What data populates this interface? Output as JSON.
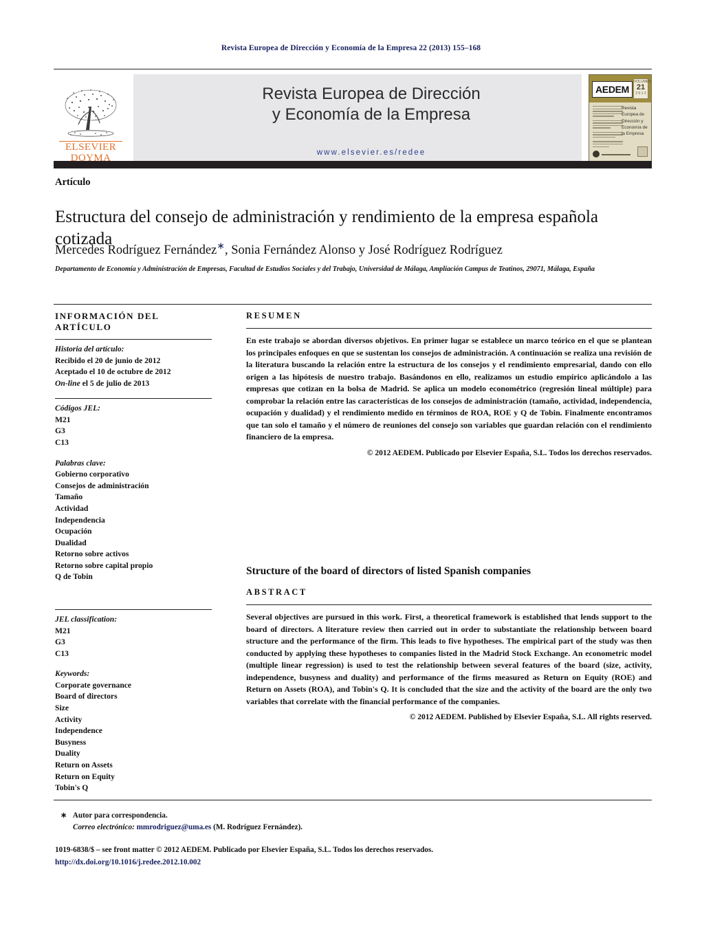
{
  "running_header": "Revista Europea de Dirección y Economía de la Empresa 22 (2013) 155–168",
  "masthead": {
    "publisher_primary": "ELSEVIER",
    "publisher_secondary": "DOYMA",
    "journal_title_line1": "Revista Europea de Dirección",
    "journal_title_line2": "y Economía de la Empresa",
    "journal_url": "www.elsevier.es/redee",
    "cover": {
      "society": "AEDEM",
      "volume_badge_top": "VOLUMEN",
      "volume_badge_number": "21",
      "volume_badge_bottom": "2 0 1 2",
      "cover_title": "Revista Europea de Dirección y Economía de la Empresa"
    }
  },
  "article": {
    "type": "Artículo",
    "title": "Estructura del consejo de administración y rendimiento de la empresa española cotizada",
    "authors": "Mercedes Rodríguez Fernández",
    "authors_rest": ",  Sonia Fernández Alonso y José Rodríguez Rodríguez",
    "corresponding_marker": "∗",
    "affiliation": "Departamento de Economía y Administración de Empresas, Facultad de Estudios Sociales y del Trabajo, Universidad de Málaga, Ampliación Campus de Teatinos, 29071, Málaga, España"
  },
  "info_panel": {
    "heading": "INFORMACIÓN DEL ARTÍCULO",
    "history_label": "Historia del artículo:",
    "history": [
      "Recibido el 20 de junio de 2012",
      "Aceptado el 10 de octubre de 2012"
    ],
    "online_prefix": "On-line",
    "online_rest": " el 5 de julio de 2013",
    "jel_label": "Códigos JEL:",
    "jel_codes": [
      "M21",
      "G3",
      "C13"
    ],
    "keywords_label": "Palabras clave:",
    "keywords": [
      "Gobierno corporativo",
      "Consejos de administración",
      "Tamaño",
      "Actividad",
      "Independencia",
      "Ocupación",
      "Dualidad",
      "Retorno sobre activos",
      "Retorno sobre capital propio",
      "Q de Tobin"
    ],
    "jel_label_en": "JEL classification:",
    "jel_codes_en": [
      "M21",
      "G3",
      "C13"
    ],
    "keywords_label_en": "Keywords:",
    "keywords_en": [
      "Corporate governance",
      "Board of directors",
      "Size",
      "Activity",
      "Independence",
      "Busyness",
      "Duality",
      "Return on Assets",
      "Return on Equity",
      "Tobin's Q"
    ]
  },
  "abstract_es": {
    "heading": "RESUMEN",
    "body": "En este trabajo se abordan diversos objetivos. En primer lugar se establece un marco teórico en el que se plantean los principales enfoques en que se sustentan los consejos de administración. A continuación se realiza una revisión de la literatura buscando la relación entre la estructura de los consejos y el rendimiento empresarial, dando con ello origen a las hipótesis de nuestro trabajo. Basándonos en ello, realizamos un estudio empírico aplicándolo a las empresas que cotizan en la bolsa de Madrid. Se aplica un modelo econométrico (regresión lineal múltiple) para comprobar la relación entre las características de los consejos de administración (tamaño, actividad, independencia, ocupación y dualidad) y el rendimiento medido en términos de ROA, ROE y Q de Tobin. Finalmente encontramos que tan solo el tamaño y el número de reuniones del consejo son variables que guardan relación con el rendimiento financiero de la empresa.",
    "copyright": "© 2012 AEDEM. Publicado por Elsevier España, S.L. Todos los derechos reservados."
  },
  "abstract_en": {
    "title": "Structure of the board of directors of listed Spanish companies",
    "heading": "ABSTRACT",
    "body": "Several objectives are pursued in this work. First, a theoretical framework is established that lends support to the board of directors. A literature review then carried out in order to substantiate the relationship between board structure and the performance of the firm. This leads to five hypotheses. The empirical part of the study was then conducted by applying these hypotheses to companies listed in the Madrid Stock Exchange. An econometric model (multiple linear regression) is used to test the relationship between several features of the board (size, activity, independence, busyness and duality) and performance of the firms measured as Return on Equity (ROE) and Return on Assets (ROA), and Tobin's Q. It is concluded that the size and the activity of the board are the only two variables that correlate with the financial performance of the companies.",
    "copyright": "© 2012 AEDEM. Published by Elsevier España, S.L. All rights reserved."
  },
  "footer": {
    "corresponding_marker": "∗",
    "corresponding_text": "Autor para correspondencia.",
    "email_label": "Correo electrónico:",
    "email": "mmrodriguez@uma.es",
    "email_owner": "(M. Rodríguez Fernández).",
    "front_matter": "1019-6838/$ – see front matter © 2012 AEDEM. Publicado por Elsevier España, S.L. Todos los derechos reservados.",
    "doi": "http://dx.doi.org/10.1016/j.redee.2012.10.002"
  }
}
